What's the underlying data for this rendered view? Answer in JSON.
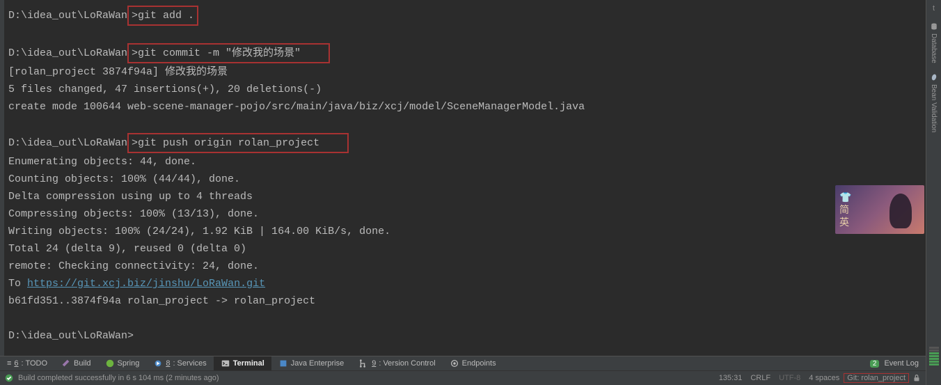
{
  "terminal": {
    "lines": [
      {
        "prompt": "D:\\idea_out\\LoRaWan>",
        "cmd": "git add .",
        "hl": true
      },
      {
        "blank": true
      },
      {
        "prompt": "D:\\idea_out\\LoRaWan>",
        "cmd": "git commit -m \"修改我的场景\"",
        "hl": true,
        "wide": true
      },
      {
        "text": "[rolan_project 3874f94a] 修改我的场景"
      },
      {
        "text": " 5 files changed, 47 insertions(+), 20 deletions(-)"
      },
      {
        "text": " create mode 100644 web-scene-manager-pojo/src/main/java/biz/xcj/model/SceneManagerModel.java"
      },
      {
        "blank": true
      },
      {
        "prompt": "D:\\idea_out\\LoRaWan>",
        "cmd": "git push origin rolan_project",
        "hl": true,
        "wide": true
      },
      {
        "text": "Enumerating objects: 44, done."
      },
      {
        "text": "Counting objects: 100% (44/44), done."
      },
      {
        "text": "Delta compression using up to 4 threads"
      },
      {
        "text": "Compressing objects: 100% (13/13), done."
      },
      {
        "text": "Writing objects: 100% (24/24), 1.92 KiB | 164.00 KiB/s, done."
      },
      {
        "text": "Total 24 (delta 9), reused 0 (delta 0)"
      },
      {
        "text": "remote: Checking connectivity: 24, done."
      },
      {
        "text": "To ",
        "link": "https://git.xcj.biz/jinshu/LoRaWan.git"
      },
      {
        "text": "   b61fd351..3874f94a  rolan_project -> rolan_project"
      },
      {
        "blank": true
      },
      {
        "prompt": "D:\\idea_out\\LoRaWan>",
        "cmd": ""
      }
    ]
  },
  "tool_tabs": {
    "todo_prefix": "≡ ",
    "todo_num": "6",
    "todo_label": ": TODO",
    "build": "Build",
    "spring": "Spring",
    "services_num": "8",
    "services_label": ": Services",
    "terminal": "Terminal",
    "java_enterprise": "Java Enterprise",
    "vc_num": "9",
    "vc_label": ": Version Control",
    "endpoints": "Endpoints",
    "event_count": "2",
    "event_log": "Event Log"
  },
  "status": {
    "build_msg": "Build completed successfully in 6 s 104 ms (2 minutes ago)",
    "cursor": "135:31",
    "line_sep": "CRLF",
    "encoding": "UTF-8",
    "indent": "4 spaces",
    "git_prefix": "Git: ",
    "git_branch": "rolan_project"
  },
  "right_tabs": {
    "database": "Database",
    "bean_validation": "Bean Validation"
  },
  "thumbnail": {
    "icon": "👕",
    "line1": "简",
    "line2": "英"
  }
}
